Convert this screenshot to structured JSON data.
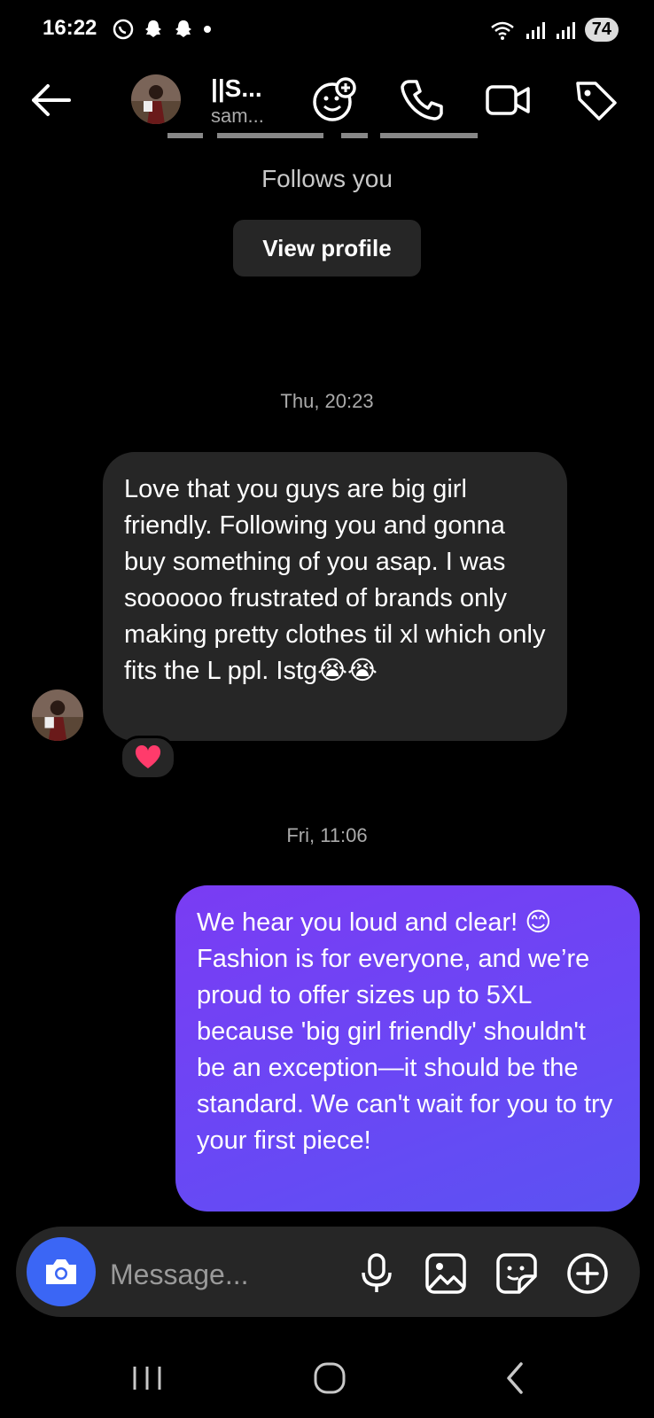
{
  "status_bar": {
    "time": "16:22",
    "battery": "74"
  },
  "header": {
    "name": "||S...",
    "username": "sam..."
  },
  "profile": {
    "follows_text": "Follows you",
    "view_profile_label": "View profile"
  },
  "messages": [
    {
      "timestamp": "Thu, 20:23",
      "direction": "incoming",
      "text": "Love that you guys are big girl friendly. Following you and gonna buy something of you asap. I was soooooo frustrated of brands only making pretty clothes til xl which only fits the L ppl. Istg😭😭",
      "reaction": "❤"
    },
    {
      "timestamp": "Fri, 11:06",
      "direction": "outgoing",
      "text": "We hear you loud and clear! 😊 Fashion is for everyone, and we’re proud to offer sizes up to 5XL because 'big girl friendly' shouldn't be an exception—it should be the standard. We can't wait for you to try your first piece!"
    }
  ],
  "composer": {
    "placeholder": "Message..."
  },
  "colors": {
    "background": "#000000",
    "incoming_bubble": "#262626",
    "outgoing_bubble_start": "#7a3cf3",
    "outgoing_bubble_end": "#5b52f2",
    "camera_button": "#3b66f5",
    "reaction_heart": "#ff3b6b"
  }
}
